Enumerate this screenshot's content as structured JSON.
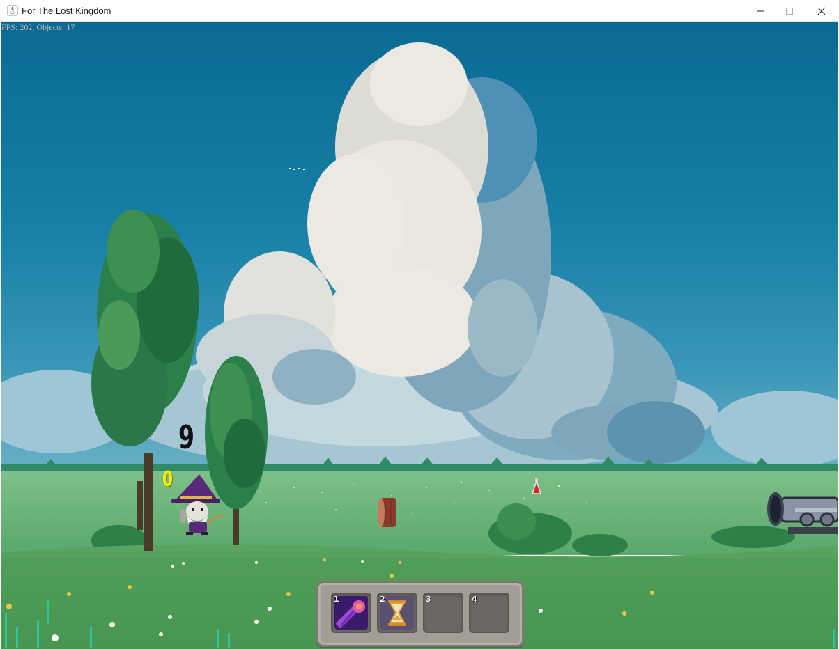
{
  "window": {
    "title": "For The Lost Kingdom",
    "controls": [
      "minimize",
      "maximize",
      "close"
    ]
  },
  "hud": {
    "fps_readout": "FPS: 202, Objects: 17",
    "floating_numbers": [
      "9",
      "0"
    ]
  },
  "hotbar": {
    "slots": [
      {
        "number": "1",
        "icon": "purple-orb-spell-icon",
        "filled": true
      },
      {
        "number": "2",
        "icon": "hourglass-icon",
        "filled": true
      },
      {
        "number": "3",
        "icon": "",
        "filled": false
      },
      {
        "number": "4",
        "icon": "",
        "filled": false
      }
    ]
  },
  "scene": {
    "objects": [
      "wizard-player",
      "red-potion",
      "log-stump",
      "cannon-enemy",
      "trees",
      "clouds",
      "meadow"
    ]
  },
  "colors": {
    "sky_top": "#0a6a94",
    "sky_bottom": "#3a96b8",
    "grass": "#5aa86a",
    "dark_grass": "#3e8e48",
    "cloud": "#ece9e2",
    "wizard_hat": "#5a2a7a"
  }
}
